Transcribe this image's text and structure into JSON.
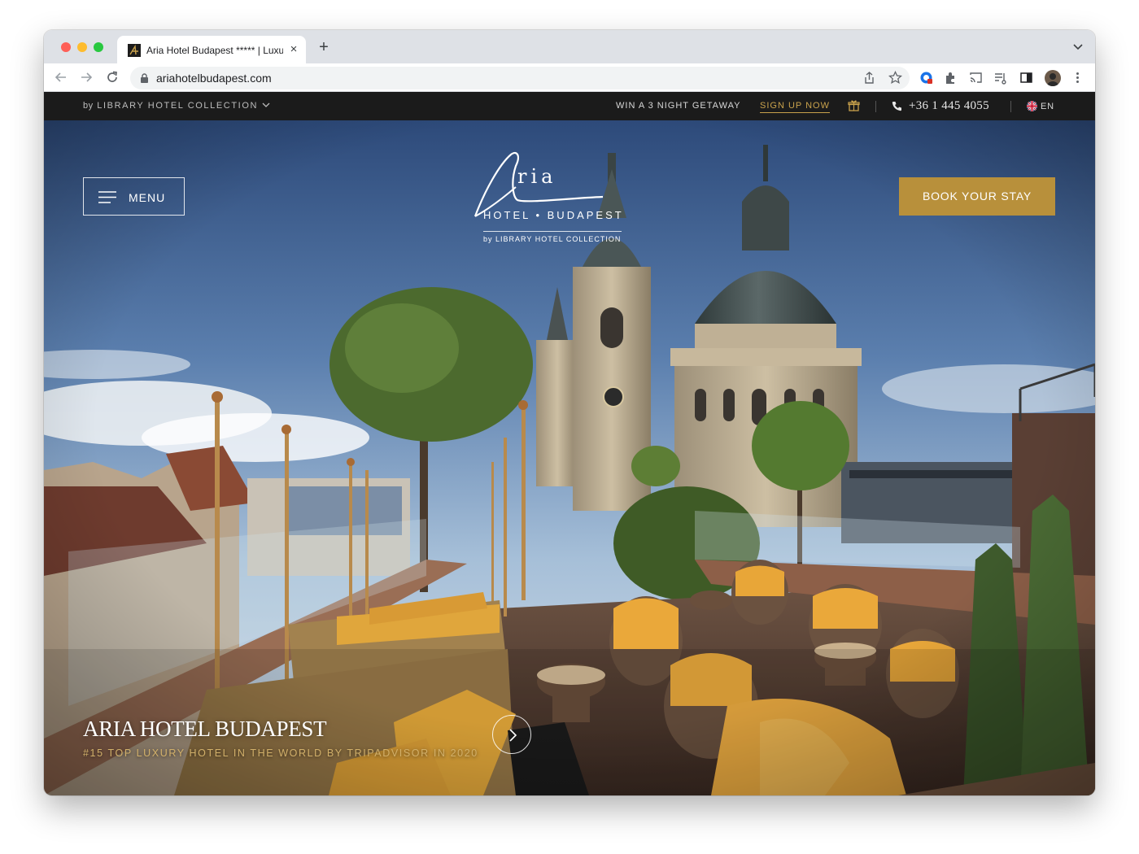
{
  "browser": {
    "tab_title": "Aria Hotel Budapest ***** | Luxury Hotel",
    "tab_close": "×",
    "new_tab": "+",
    "url": "ariahotelbudapest.com"
  },
  "topbar": {
    "collection_by": "by",
    "collection_label": "LIBRARY HOTEL COLLECTION",
    "promo": "WIN A 3 NIGHT GETAWAY",
    "signup": "SIGN UP NOW",
    "phone": "+36 1 445 4055",
    "language": "EN"
  },
  "header": {
    "menu_label": "MENU",
    "book_label": "BOOK YOUR STAY",
    "logo_script": "ria",
    "logo_name": "HOTEL • BUDAPEST",
    "logo_sub": "by LIBRARY HOTEL COLLECTION"
  },
  "hero": {
    "title": "ARIA HOTEL BUDAPEST",
    "subtitle": "#15 TOP LUXURY HOTEL IN THE WORLD BY TRIPADVISOR IN 2020"
  },
  "icons": {
    "back": "arrow-left-icon",
    "forward": "arrow-right-icon",
    "reload": "reload-icon",
    "lock": "lock-icon",
    "share": "share-icon",
    "bookmark": "star-icon",
    "extensions": "puzzle-icon",
    "gift": "gift-icon",
    "phone": "phone-icon",
    "menu": "hamburger-icon",
    "next": "chevron-right-icon"
  },
  "colors": {
    "brand_gold": "#b8903b",
    "topbar_bg": "#1b1b1b",
    "signup_gold": "#c9a24c"
  }
}
